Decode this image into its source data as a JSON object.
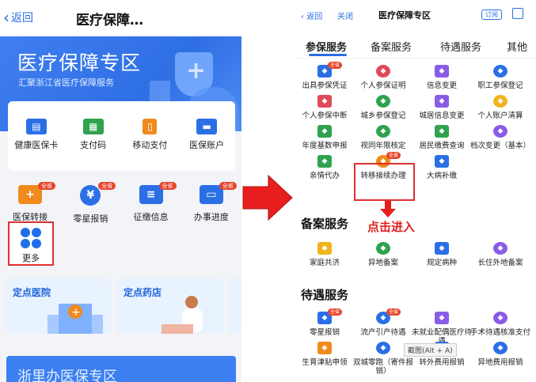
{
  "left": {
    "back_label": "返回",
    "title": "医疗保障…",
    "banner_title": "医疗保障专区",
    "banner_subtitle": "汇聚浙江省医疗保障服务",
    "services": [
      {
        "label": "健康医保卡",
        "icon": "id-card-icon",
        "color": "#2b6fe6"
      },
      {
        "label": "支付码",
        "icon": "qr-code-icon",
        "color": "#2fa34e"
      },
      {
        "label": "移动支付",
        "icon": "phone-icon",
        "color": "#f08a1c"
      },
      {
        "label": "医保账户",
        "icon": "wallet-icon",
        "color": "#2b6fe6"
      }
    ],
    "services2": [
      {
        "label": "医保转接",
        "icon": "transfer-icon",
        "color": "#f08a1c",
        "badge": "全省"
      },
      {
        "label": "零星报销",
        "icon": "yuan-icon",
        "color": "#2b6fe6",
        "badge": "全省"
      },
      {
        "label": "征缴信息",
        "icon": "document-search-icon",
        "color": "#2b6fe6",
        "badge": "全省"
      },
      {
        "label": "办事进度",
        "icon": "monitor-icon",
        "color": "#2b6fe6",
        "badge": "全省"
      }
    ],
    "more_label": "更多",
    "tile1": "定点医院",
    "tile2": "定点药店",
    "bottom_text": "浙里办医保专区"
  },
  "right": {
    "back_label": "返回",
    "close_label": "关闭",
    "title": "医疗保障专区",
    "subscribe_label": "订阅",
    "tabs": [
      "参保服务",
      "备案服务",
      "待遇服务",
      "其他"
    ],
    "insurance": [
      {
        "label": "出具参保凭证",
        "color": "#2b6fe6",
        "badge": "全省"
      },
      {
        "label": "个人参保证明",
        "color": "#e04a5a"
      },
      {
        "label": "信息变更",
        "color": "#8a5ce6"
      },
      {
        "label": "职工参保登记",
        "color": "#2b6fe6"
      },
      {
        "label": "个人参保中断",
        "color": "#e04a5a"
      },
      {
        "label": "城乡参保登记",
        "color": "#2fa34e"
      },
      {
        "label": "城居信息变更",
        "color": "#8a5ce6"
      },
      {
        "label": "个人账户清算",
        "color": "#f0b41c"
      },
      {
        "label": "年度基数申报",
        "color": "#2fa34e"
      },
      {
        "label": "视同年限核定",
        "color": "#2fa34e"
      },
      {
        "label": "居民缴费查询",
        "color": "#2fa34e"
      },
      {
        "label": "档次变更（基本）",
        "color": "#8a5ce6"
      },
      {
        "label": "亲情代办",
        "color": "#2fa34e"
      },
      {
        "label": "转移接续办理",
        "color": "#f08a1c",
        "badge": "全省"
      },
      {
        "label": "大病补缴",
        "color": "#2b6fe6"
      }
    ],
    "click_hint": "点击进入",
    "filing_title": "备案服务",
    "filing": [
      {
        "label": "家庭共济",
        "color": "#f0b41c"
      },
      {
        "label": "异地备案",
        "color": "#2fa34e"
      },
      {
        "label": "规定病种",
        "color": "#2b6fe6"
      },
      {
        "label": "长住外地备案",
        "color": "#8a5ce6"
      }
    ],
    "benefit_title": "待遇服务",
    "benefit": [
      {
        "label": "零星报销",
        "color": "#2b6fe6",
        "badge": "全省"
      },
      {
        "label": "流产引产待遇",
        "color": "#2b6fe6",
        "badge": "全省"
      },
      {
        "label": "未就业配偶医疗待遇",
        "color": "#8a5ce6"
      },
      {
        "label": "手术待遇核准支付",
        "color": "#8a5ce6"
      },
      {
        "label": "生育津贴申领",
        "color": "#f08a1c"
      },
      {
        "label": "双城零跑（寄件报销）",
        "color": "#2b6fe6"
      },
      {
        "label": "转外费用报销",
        "color": "#2b6fe6"
      },
      {
        "label": "异地费用报销",
        "color": "#2b6fe6"
      }
    ],
    "tooltip": "截图(Alt + A)"
  },
  "colors": {
    "accent": "#2a6ee8",
    "highlight": "#e03030"
  }
}
